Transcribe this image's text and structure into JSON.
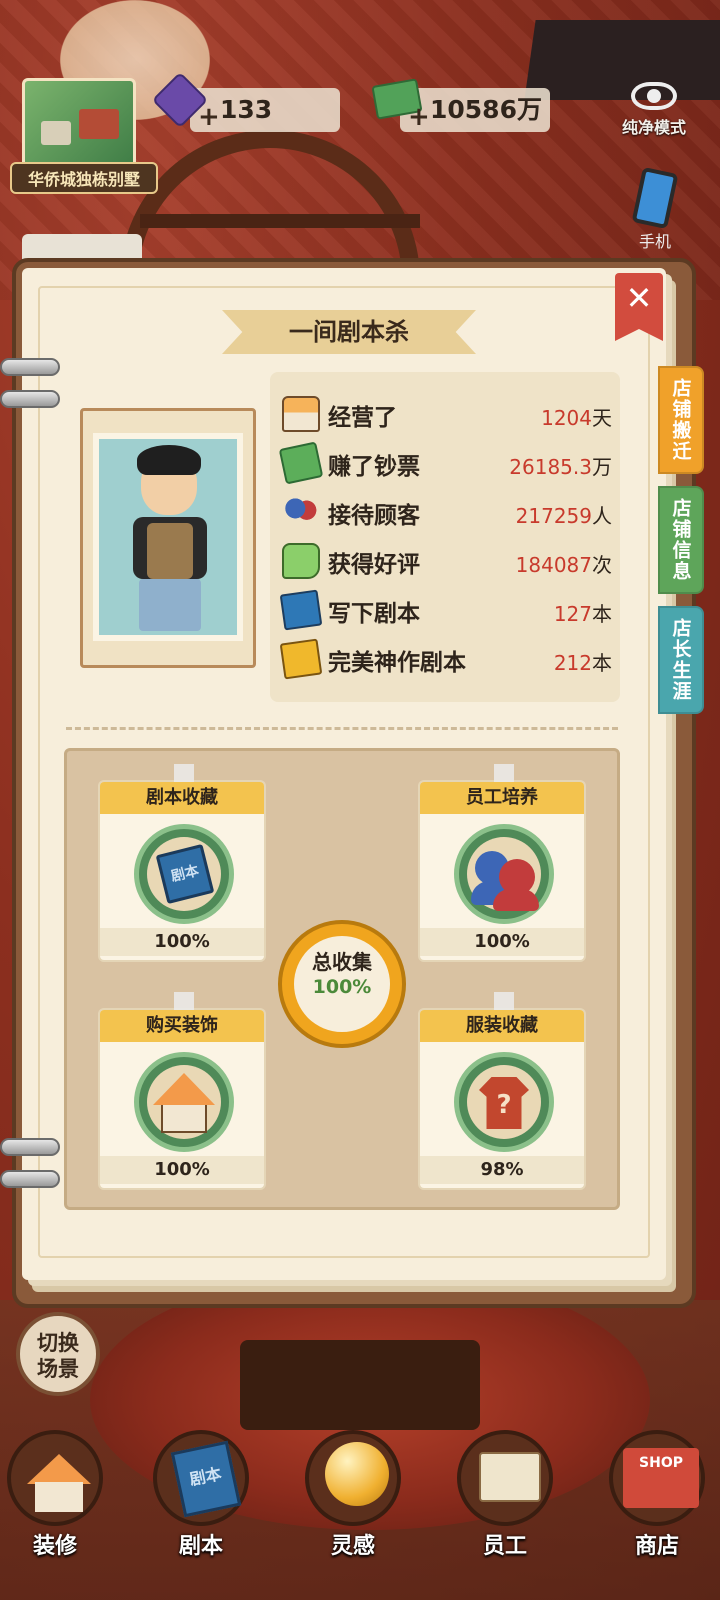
{
  "hud": {
    "location_name": "华侨城独栋别墅",
    "gems": "133",
    "cash": "10586万",
    "pure_mode_label": "纯净模式",
    "phone_label": "手机"
  },
  "panel": {
    "title": "一间剧本杀",
    "close_glyph": "✕",
    "side_tabs": [
      "店铺搬迁",
      "店铺信息",
      "店长生涯"
    ],
    "side_tab_colors": [
      "#f0a12a",
      "#5ea55a",
      "#4aa6ad"
    ]
  },
  "stats": [
    {
      "label": "经营了",
      "value": "1204",
      "unit": "天",
      "icon": "house-icon"
    },
    {
      "label": "赚了钞票",
      "value": "26185.3",
      "unit": "万",
      "icon": "money-icon"
    },
    {
      "label": "接待顾客",
      "value": "217259",
      "unit": "人",
      "icon": "customers-icon"
    },
    {
      "label": "获得好评",
      "value": "184087",
      "unit": "次",
      "icon": "thumbs-up-icon"
    },
    {
      "label": "写下剧本",
      "value": "127",
      "unit": "本",
      "icon": "script-book-icon"
    },
    {
      "label": "完美神作剧本",
      "value": "212",
      "unit": "本",
      "icon": "gold-script-icon"
    }
  ],
  "collection": {
    "cards": [
      {
        "title": "剧本收藏",
        "percent": "100%",
        "icon": "script-book-icon",
        "book_text": "剧本"
      },
      {
        "title": "员工培养",
        "percent": "100%",
        "icon": "staff-icon"
      },
      {
        "title": "购买装饰",
        "percent": "100%",
        "icon": "house-icon"
      },
      {
        "title": "服装收藏",
        "percent": "98%",
        "icon": "shirt-icon",
        "shirt_text": "?"
      }
    ],
    "total_label": "总收集",
    "total_value": "100%"
  },
  "bottom": {
    "switch_scene_line1": "切换",
    "switch_scene_line2": "场景",
    "nav": [
      "装修",
      "剧本",
      "灵感",
      "员工",
      "商店"
    ],
    "nav_script_book_text": "剧本",
    "nav_shop_text": "SHOP"
  },
  "colors": {
    "accent_red": "#c83a2c",
    "card_title_yellow": "#f3c34e",
    "ring_green": "#4f8a58",
    "total_orange": "#f0a51e"
  }
}
